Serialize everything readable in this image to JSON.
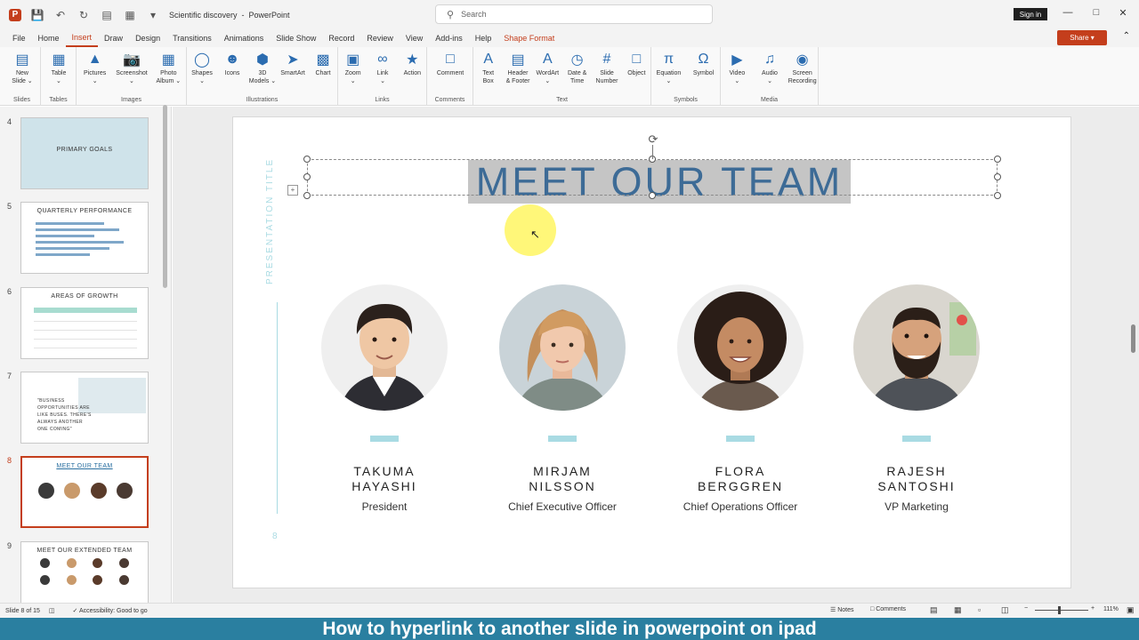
{
  "window": {
    "doc_title": "Scientific discovery",
    "app_name": "PowerPoint",
    "search_placeholder": "Search",
    "signin_label": "Sign in"
  },
  "menu": {
    "tabs": [
      "File",
      "Home",
      "Insert",
      "Draw",
      "Design",
      "Transitions",
      "Animations",
      "Slide Show",
      "Record",
      "Review",
      "View",
      "Add-ins",
      "Help",
      "Shape Format"
    ],
    "active_tab": "Insert",
    "share_label": "Share"
  },
  "ribbon": {
    "groups": [
      {
        "label": "Slides",
        "buttons": [
          "New\nSlide ⌄"
        ]
      },
      {
        "label": "Tables",
        "buttons": [
          "Table\n⌄"
        ]
      },
      {
        "label": "Images",
        "buttons": [
          "Pictures\n⌄",
          "Screenshot\n⌄",
          "Photo\nAlbum ⌄"
        ]
      },
      {
        "label": "Illustrations",
        "buttons": [
          "Shapes\n⌄",
          "Icons",
          "3D\nModels ⌄",
          "SmartArt",
          "Chart"
        ]
      },
      {
        "label": "Links",
        "buttons": [
          "Zoom\n⌄",
          "Link\n⌄",
          "Action"
        ]
      },
      {
        "label": "Comments",
        "buttons": [
          "Comment"
        ]
      },
      {
        "label": "Text",
        "buttons": [
          "Text\nBox",
          "Header\n& Footer",
          "WordArt\n⌄",
          "Date &\nTime",
          "Slide\nNumber",
          "Object"
        ]
      },
      {
        "label": "Symbols",
        "buttons": [
          "Equation\n⌄",
          "Symbol"
        ]
      },
      {
        "label": "Media",
        "buttons": [
          "Video\n⌄",
          "Audio\n⌄",
          "Screen\nRecording"
        ]
      }
    ]
  },
  "thumbnails": [
    {
      "num": "4",
      "title": "PRIMARY GOALS"
    },
    {
      "num": "5",
      "title": "QUARTERLY PERFORMANCE"
    },
    {
      "num": "6",
      "title": "AREAS OF GROWTH"
    },
    {
      "num": "7",
      "title": "\"BUSINESS OPPORTUNITIES ARE LIKE BUSES. THERE'S ALWAYS ANOTHER ONE COMING\""
    },
    {
      "num": "8",
      "title": "MEET OUR TEAM"
    },
    {
      "num": "9",
      "title": "MEET OUR EXTENDED TEAM"
    }
  ],
  "slide": {
    "vertical_title": "PRESENTATION TITLE",
    "title": "MEET OUR TEAM",
    "number": "8",
    "members": [
      {
        "name": "TAKUMA\nHAYASHI",
        "role": "President"
      },
      {
        "name": "MIRJAM\nNILSSON",
        "role": "Chief Executive Officer"
      },
      {
        "name": "FLORA\nBERGGREN",
        "role": "Chief Operations Officer"
      },
      {
        "name": "RAJESH\nSANTOSHI",
        "role": "VP Marketing"
      }
    ]
  },
  "status": {
    "slide_info": "Slide 8 of 15",
    "accessibility": "Accessibility: Good to go",
    "notes": "Notes",
    "comments": "Comments",
    "zoom": "111%"
  },
  "caption": "How to hyperlink to another slide in powerpoint on ipad",
  "colors": {
    "accent": "#c43e1c",
    "title_text": "#3d6b96",
    "slide_accent": "#a9dbe3",
    "caption_bg": "#2a7fa0"
  }
}
